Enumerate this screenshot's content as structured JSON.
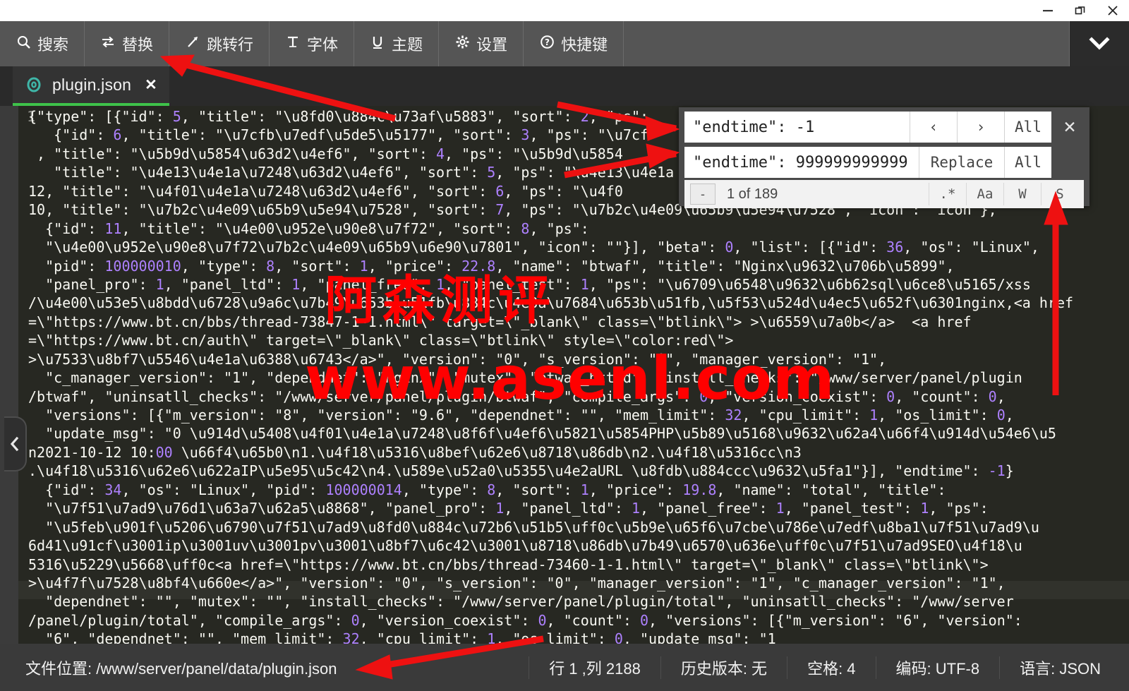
{
  "window": {
    "controls": [
      {
        "name": "minimize",
        "glyph": "—"
      },
      {
        "name": "maximize",
        "glyph": "❐"
      },
      {
        "name": "close",
        "glyph": "✕"
      }
    ]
  },
  "toolbar": {
    "items": [
      {
        "icon": "search-icon",
        "glyph": "⌕",
        "label": "搜索"
      },
      {
        "icon": "replace-icon",
        "glyph": "⇄",
        "label": "替换"
      },
      {
        "icon": "goto-line-icon",
        "glyph": "↗",
        "label": "跳转行"
      },
      {
        "icon": "font-icon",
        "glyph": "T",
        "label": "字体"
      },
      {
        "icon": "theme-icon",
        "glyph": "U",
        "label": "主题"
      },
      {
        "icon": "settings-icon",
        "glyph": "⚙",
        "label": "设置"
      },
      {
        "icon": "shortcuts-icon",
        "glyph": "?",
        "label": "快捷键"
      }
    ],
    "collapse_icon": "chevron-down-icon"
  },
  "tab": {
    "icon": "json-file-icon",
    "label": "plugin.json",
    "close_glyph": "✕"
  },
  "find_panel": {
    "find_value": "\"endtime\": -1",
    "replace_value": "\"endtime\": 999999999999",
    "prev_glyph": "‹",
    "next_glyph": "›",
    "find_all_label": "All",
    "close_glyph": "✕",
    "replace_label": "Replace",
    "replace_all_label": "All",
    "toggle_glyph": "-",
    "match_count": "1 of 189",
    "options": [
      {
        "name": "regex-toggle",
        "label": ".*"
      },
      {
        "name": "match-case-toggle",
        "label": "Aa"
      },
      {
        "name": "whole-word-toggle",
        "label": "W"
      },
      {
        "name": "selection-toggle",
        "label": "S"
      }
    ]
  },
  "editor": {
    "line_number": "1",
    "collapse_handle_glyph": "‹",
    "watermark_cn": "阿森测评",
    "watermark_url": "www.asenl.com",
    "lines": [
      "{\"type\": [{\"id\": 5, \"title\": \"\\u8fd0\\u884c\\u73af\\u5883\", \"sort\": 2, \"ps\":",
      "   {\"id\": 6, \"title\": \"\\u7cfb\\u7edf\\u5de5\\u5177\", \"sort\": 3, \"ps\": \"\\u7cf",
      " , \"title\": \"\\u5b9d\\u5854\\u63d2\\u4ef6\", \"sort\": 4, \"ps\": \"\\u5b9d\\u5854",
      "   \"title\": \"\\u4e13\\u4e1a\\u7248\\u63d2\\u4ef6\", \"sort\": 5, \"ps\": \"\\u4e13\\u4e1a",
      "12, \"title\": \"\\u4f01\\u4e1a\\u7248\\u63d2\\u4ef6\", \"sort\": 6, \"ps\": \"\\u4f0",
      "10, \"title\": \"\\u7b2c\\u4e09\\u65b9\\u5e94\\u7528\", \"sort\": 7, \"ps\": \"\\u7b2c\\u4e09\\u65b9\\u5e94\\u7528\", \"icon\": \"icon\"},",
      "  {\"id\": 11, \"title\": \"\\u4e00\\u952e\\u90e8\\u7f72\", \"sort\": 8, \"ps\":",
      "  \"\\u4e00\\u952e\\u90e8\\u7f72\\u7b2c\\u4e09\\u65b9\\u6e90\\u7801\", \"icon\": \"\"}], \"beta\": 0, \"list\": [{\"id\": 36, \"os\": \"Linux\",",
      "  \"pid\": 100000010, \"type\": 8, \"sort\": 1, \"price\": 22.8, \"name\": \"btwaf\", \"title\": \"Nginx\\u9632\\u706b\\u5899\",",
      "  \"panel_pro\": 1, \"panel_ltd\": 1, \"panel_free\": 1, \"panel_test\": 1, \"ps\": \"\\u6709\\u6548\\u9632\\u6b62sql\\u6ce8\\u5165/xss",
      "/\\u4e00\\u53e5\\u8bdd\\u6728\\u9a6c\\u7b49\\u653b\\u51fb\\u884c\\u4e3a\\u7684\\u653b\\u51fb,\\u5f53\\u524d\\u4ec5\\u652f\\u6301nginx,<a href",
      "=\\\"https://www.bt.cn/bbs/thread-73847-1-1.html\\\" target=\\\"_blank\\\" class=\\\"btlink\\\"> >\\u6559\\u7a0b</a>  <a href",
      "=\\\"https://www.bt.cn/auth\\\" target=\\\"_blank\\\" class=\\\"btlink\\\" style=\\\"color:red\\\">",
      ">\\u7533\\u8bf7\\u5546\\u4e1a\\u6388\\u6743</a>\", \"version\": \"0\", \"s_version\": \"0\", \"manager_version\": \"1\",",
      "  \"c_manager_version\": \"1\", \"dependnet\": \"nginx\", \"mutex\": \"btwaf_httpd\", \"install_checks\": \"/www/server/panel/plugin",
      "/btwaf\", \"uninsatll_checks\": \"/www/server/panel/plugin/btwaf\", \"compile_args\": 0, \"version_coexist\": 0, \"count\": 0,",
      "  \"versions\": [{\"m_version\": \"8\", \"version\": \"9.6\", \"dependnet\": \"\", \"mem_limit\": 32, \"cpu_limit\": 1, \"os_limit\": 0,",
      "  \"update_msg\": \"0 \\u914d\\u5408\\u4f01\\u4e1a\\u7248\\u8f6f\\u4ef6\\u5821\\u5854PHP\\u5b89\\u5168\\u9632\\u62a4\\u66f4\\u914d\\u54e6\\u5",
      "n2021-10-12 10:00 \\u66f4\\u65b0\\n1.\\u4f18\\u5316\\u8bef\\u62e6\\u8718\\u86db\\n2.\\u4f18\\u5316cc\\n3",
      ".\\u4f18\\u5316\\u62e6\\u622aIP\\u5e95\\u5c42\\n4.\\u589e\\u52a0\\u5355\\u4e2aURL \\u8fdb\\u884ccc\\u9632\\u5fa1\"}], \"endtime\": -1}",
      "  {\"id\": 34, \"os\": \"Linux\", \"pid\": 100000014, \"type\": 8, \"sort\": 1, \"price\": 19.8, \"name\": \"total\", \"title\":",
      "  \"\\u7f51\\u7ad9\\u76d1\\u63a7\\u62a5\\u8868\", \"panel_pro\": 1, \"panel_ltd\": 1, \"panel_free\": 1, \"panel_test\": 1, \"ps\":",
      "  \"\\u5feb\\u901f\\u5206\\u6790\\u7f51\\u7ad9\\u8fd0\\u884c\\u72b6\\u51b5\\uff0c\\u5b9e\\u65f6\\u7cbe\\u786e\\u7edf\\u8ba1\\u7f51\\u7ad9\\u",
      "6d41\\u91cf\\u3001ip\\u3001uv\\u3001pv\\u3001\\u8bf7\\u6c42\\u3001\\u8718\\u86db\\u7b49\\u6570\\u636e\\uff0c\\u7f51\\u7ad9SEO\\u4f18\\u",
      "5316\\u5229\\u5668\\uff0c<a href=\\\"https://www.bt.cn/bbs/thread-73460-1-1.html\\\" target=\\\"_blank\\\" class=\\\"btlink\\\">",
      ">\\u4f7f\\u7528\\u8bf4\\u660e</a>\", \"version\": \"0\", \"s_version\": \"0\", \"manager_version\": \"1\", \"c_manager_version\": \"1\",",
      "  \"dependnet\": \"\", \"mutex\": \"\", \"install_checks\": \"/www/server/panel/plugin/total\", \"uninsatll_checks\": \"/www/server",
      "/panel/plugin/total\", \"compile_args\": 0, \"version_coexist\": 0, \"count\": 0, \"versions\": [{\"m_version\": \"6\", \"version\":",
      "  \"6\", \"dependnet\": \"\", \"mem_limit\": 32, \"cpu_limit\": 1, \"os_limit\": 0, \"update_msg\": \"1"
    ]
  },
  "status_bar": {
    "file_location_label": "文件位置:",
    "file_location_value": "/www/server/panel/data/plugin.json",
    "cells": [
      "行 1 ,列 2188",
      "历史版本: 无",
      "空格: 4",
      "编码: UTF-8",
      "语言: JSON"
    ]
  },
  "colors": {
    "toolbar_bg": "#555555",
    "editor_bg": "#272822",
    "tab_underline": "#3ec24a",
    "annotation": "#ff0000",
    "status_bg": "#3a3a3a"
  }
}
